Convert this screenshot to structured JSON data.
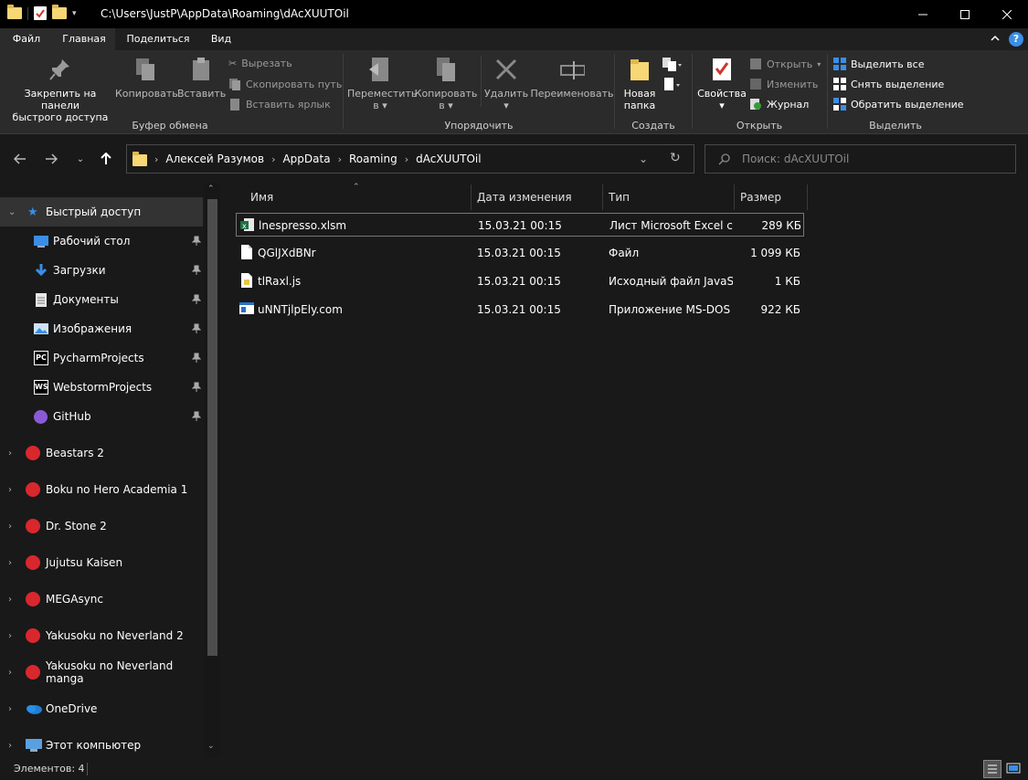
{
  "window": {
    "title": "C:\\Users\\JustP\\AppData\\Roaming\\dAcXUUTOil"
  },
  "ribbon_tabs": [
    "Файл",
    "Главная",
    "Поделиться",
    "Вид"
  ],
  "ribbon": {
    "clipboard": {
      "title": "Буфер обмена",
      "pin": "Закрепить на панели быстрого доступа",
      "pin_line1": "Закрепить на панели",
      "pin_line2": "быстрого доступа",
      "copy": "Копировать",
      "paste": "Вставить",
      "cut": "Вырезать",
      "copy_path": "Скопировать путь",
      "paste_shortcut": "Вставить ярлык"
    },
    "organize": {
      "title": "Упорядочить",
      "move_line1": "Переместить",
      "move_line2": "в",
      "copy_line1": "Копировать",
      "copy_line2": "в",
      "delete": "Удалить",
      "rename": "Переименовать"
    },
    "create": {
      "title": "Создать",
      "new_folder_line1": "Новая",
      "new_folder_line2": "папка"
    },
    "open": {
      "title": "Открыть",
      "properties": "Свойства",
      "open": "Открыть",
      "edit": "Изменить",
      "history": "Журнал"
    },
    "select": {
      "title": "Выделить",
      "select_all": "Выделить все",
      "select_none": "Снять выделение",
      "invert": "Обратить выделение"
    }
  },
  "breadcrumb": [
    "Алексей Разумов",
    "AppData",
    "Roaming",
    "dAcXUUTOil"
  ],
  "search": {
    "placeholder": "Поиск: dAcXUUTOil"
  },
  "sidebar": {
    "quick_access": "Быстрый доступ",
    "quick_items": [
      {
        "label": "Рабочий стол",
        "icon": "desktop-icon"
      },
      {
        "label": "Загрузки",
        "icon": "download-icon"
      },
      {
        "label": "Документы",
        "icon": "document-icon"
      },
      {
        "label": "Изображения",
        "icon": "pictures-icon"
      },
      {
        "label": "PycharmProjects",
        "icon": "pycharm-icon"
      },
      {
        "label": "WebstormProjects",
        "icon": "webstorm-icon"
      },
      {
        "label": "GitHub",
        "icon": "github-icon"
      }
    ],
    "folders": [
      {
        "label": "Beastars 2",
        "icon": "mega-icon"
      },
      {
        "label": "Boku no Hero Academia 1",
        "icon": "mega-icon"
      },
      {
        "label": "Dr. Stone 2",
        "icon": "mega-icon"
      },
      {
        "label": "Jujutsu Kaisen",
        "icon": "mega-icon"
      },
      {
        "label": "MEGAsync",
        "icon": "mega-icon"
      },
      {
        "label": "Yakusoku no Neverland 2",
        "icon": "mega-icon"
      },
      {
        "label": "Yakusoku no Neverland manga",
        "icon": "mega-icon"
      },
      {
        "label": "OneDrive",
        "icon": "onedrive-icon"
      },
      {
        "label": "Этот компьютер",
        "icon": "computer-icon"
      }
    ]
  },
  "columns": [
    "Имя",
    "Дата изменения",
    "Тип",
    "Размер"
  ],
  "files": [
    {
      "name": "lnespresso.xlsm",
      "date": "15.03.21 00:15",
      "type": "Лист Microsoft Excel с...",
      "size": "289 КБ",
      "icon": "excel-icon"
    },
    {
      "name": "QGlJXdBNr",
      "date": "15.03.21 00:15",
      "type": "Файл",
      "size": "1 099 КБ",
      "icon": "file-icon"
    },
    {
      "name": "tlRaxl.js",
      "date": "15.03.21 00:15",
      "type": "Исходный файл JavaS...",
      "size": "1 КБ",
      "icon": "js-icon"
    },
    {
      "name": "uNNTjlpEly.com",
      "date": "15.03.21 00:15",
      "type": "Приложение MS-DOS",
      "size": "922 КБ",
      "icon": "msdos-icon"
    }
  ],
  "status": {
    "items": "Элементов: 4"
  },
  "colors": {
    "accent": "#3a8ee6",
    "background": "#191919",
    "ribbon": "#2b2b2b"
  }
}
